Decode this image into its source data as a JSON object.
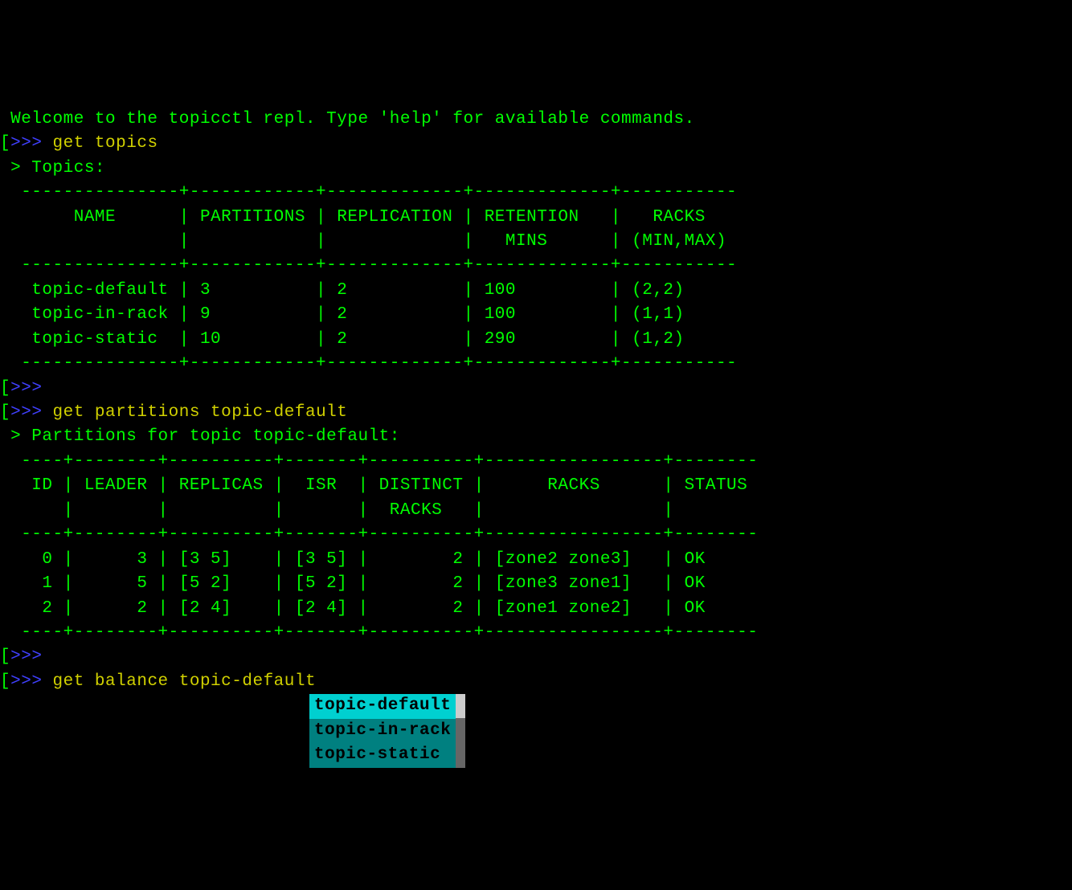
{
  "welcome": " Welcome to the topicctl repl. Type 'help' for available commands.",
  "prompt1_bracket_open": "[",
  "prompt1_arrows": ">>>",
  "cmd1": " get topics",
  "topics_heading": " > Topics:",
  "topics_border_top": "  ---------------+------------+-------------+-------------+-----------",
  "topics_header_1": "       NAME      | PARTITIONS | REPLICATION | RETENTION   |   RACKS",
  "topics_header_2": "                 |            |             |   MINS      | (MIN,MAX)",
  "topics_border_mid": "  ---------------+------------+-------------+-------------+-----------",
  "topics_row_1": "   topic-default | 3          | 2           | 100         | (2,2)",
  "topics_row_2": "   topic-in-rack | 9          | 2           | 100         | (1,1)",
  "topics_row_3": "   topic-static  | 10         | 2           | 290         | (1,2)",
  "topics_border_bot": "  ---------------+------------+-------------+-------------+-----------",
  "prompt2_bracket_open": "[",
  "prompt2_arrows": ">>>",
  "prompt3_bracket_open": "[",
  "prompt3_arrows": ">>>",
  "cmd2": " get partitions topic-default",
  "parts_heading": " > Partitions for topic topic-default:",
  "parts_border_top": "  ----+--------+----------+-------+----------+-----------------+--------",
  "parts_header_1": "   ID | LEADER | REPLICAS |  ISR  | DISTINCT |      RACKS      | STATUS",
  "parts_header_2": "      |        |          |       |  RACKS   |                 |",
  "parts_border_mid": "  ----+--------+----------+-------+----------+-----------------+--------",
  "parts_row_1": "    0 |      3 | [3 5]    | [3 5] |        2 | [zone2 zone3]   | OK",
  "parts_row_2": "    1 |      5 | [5 2]    | [5 2] |        2 | [zone3 zone1]   | OK",
  "parts_row_3": "    2 |      2 | [2 4]    | [2 4] |        2 | [zone1 zone2]   | OK",
  "parts_border_bot": "  ----+--------+----------+-------+----------+-----------------+--------",
  "prompt4_bracket_open": "[",
  "prompt4_arrows": ">>>",
  "prompt5_bracket_open": "[",
  "prompt5_arrows": ">>>",
  "cmd3": " get balance topic-default",
  "autocomplete": {
    "items": [
      {
        "label": "topic-default",
        "selected": true
      },
      {
        "label": "topic-in-rack",
        "selected": false
      },
      {
        "label": "topic-static ",
        "selected": false
      }
    ]
  },
  "chart_data": [
    {
      "type": "table",
      "title": "Topics",
      "columns": [
        "NAME",
        "PARTITIONS",
        "REPLICATION",
        "RETENTION MINS",
        "RACKS (MIN,MAX)"
      ],
      "rows": [
        [
          "topic-default",
          3,
          2,
          100,
          "(2,2)"
        ],
        [
          "topic-in-rack",
          9,
          2,
          100,
          "(1,1)"
        ],
        [
          "topic-static",
          10,
          2,
          290,
          "(1,2)"
        ]
      ]
    },
    {
      "type": "table",
      "title": "Partitions for topic topic-default",
      "columns": [
        "ID",
        "LEADER",
        "REPLICAS",
        "ISR",
        "DISTINCT RACKS",
        "RACKS",
        "STATUS"
      ],
      "rows": [
        [
          0,
          3,
          "[3 5]",
          "[3 5]",
          2,
          "[zone2 zone3]",
          "OK"
        ],
        [
          1,
          5,
          "[5 2]",
          "[5 2]",
          2,
          "[zone3 zone1]",
          "OK"
        ],
        [
          2,
          2,
          "[2 4]",
          "[2 4]",
          2,
          "[zone1 zone2]",
          "OK"
        ]
      ]
    }
  ]
}
